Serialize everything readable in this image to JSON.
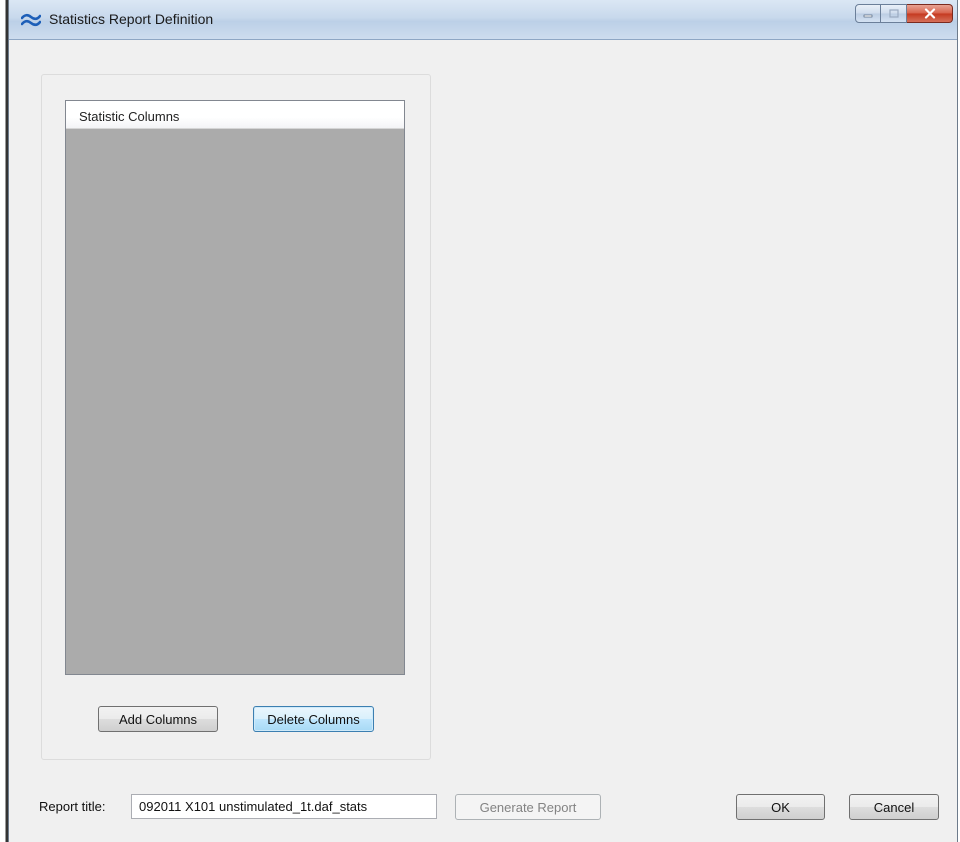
{
  "window": {
    "title": "Statistics Report Definition"
  },
  "list": {
    "column_header": "Statistic Columns",
    "items": []
  },
  "buttons": {
    "add_columns": "Add Columns",
    "delete_columns": "Delete Columns",
    "generate_report": "Generate Report",
    "ok": "OK",
    "cancel": "Cancel"
  },
  "report": {
    "title_label": "Report title:",
    "title_value": "092011 X101 unstimulated_1t.daf_stats"
  },
  "icons": {
    "app": "wave-icon",
    "minimize": "minimize-icon",
    "maximize": "maximize-icon",
    "close": "close-icon"
  }
}
